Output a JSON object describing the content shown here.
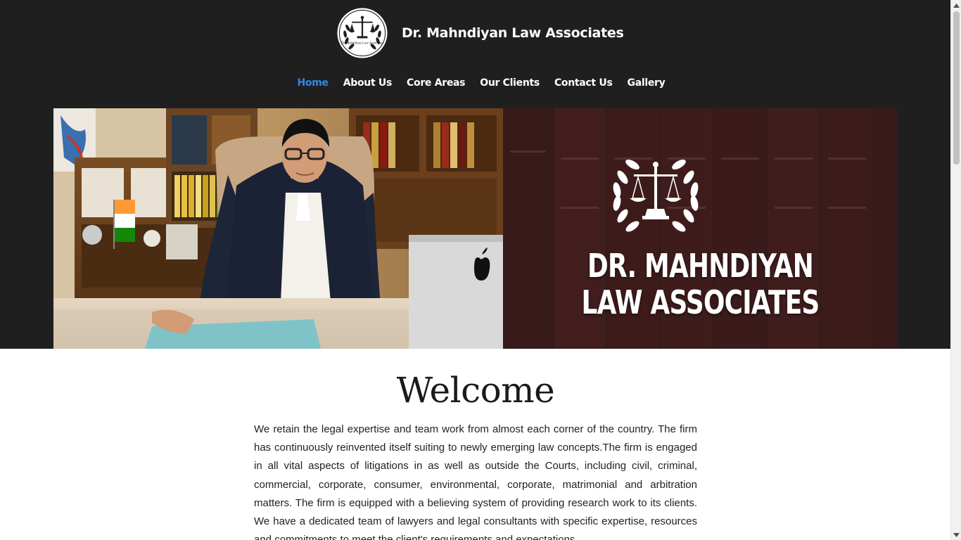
{
  "header": {
    "site_title": "Dr. Mahndiyan Law Associates",
    "logo_text": "Dr. Mahndiyan Law Associates",
    "logo_icon": "scales-of-justice-laurel-icon"
  },
  "nav": {
    "items": [
      {
        "label": "Home",
        "active": true
      },
      {
        "label": "About Us",
        "active": false
      },
      {
        "label": "Core Areas",
        "active": false
      },
      {
        "label": "Our Clients",
        "active": false
      },
      {
        "label": "Contact Us",
        "active": false
      },
      {
        "label": "Gallery",
        "active": false
      }
    ],
    "active_color": "#2e8ae8"
  },
  "hero": {
    "title_line1": "DR. MAHNDIYAN",
    "title_line2": "LAW ASSOCIATES",
    "emblem_icon": "scales-of-justice-laurel-icon"
  },
  "welcome": {
    "heading": "Welcome",
    "body": "We retain the legal expertise and team work from almost each corner of the country. The firm has continuously reinvented itself suiting to newly emerging law concepts.The firm is engaged in all vital aspects of litigations in as well as outside the Courts, including civil, criminal, commercial, corporate, consumer, environmental, corporate, matrimonial and arbitration matters. The firm is equipped with a believing system of providing research work to its clients. We have a dedicated team of lawyers and legal consultants with specific expertise, resources and commitments to meet the client's requirements and expectations."
  },
  "colors": {
    "header_bg": "#1f1f1f",
    "text_light": "#ffffff"
  }
}
